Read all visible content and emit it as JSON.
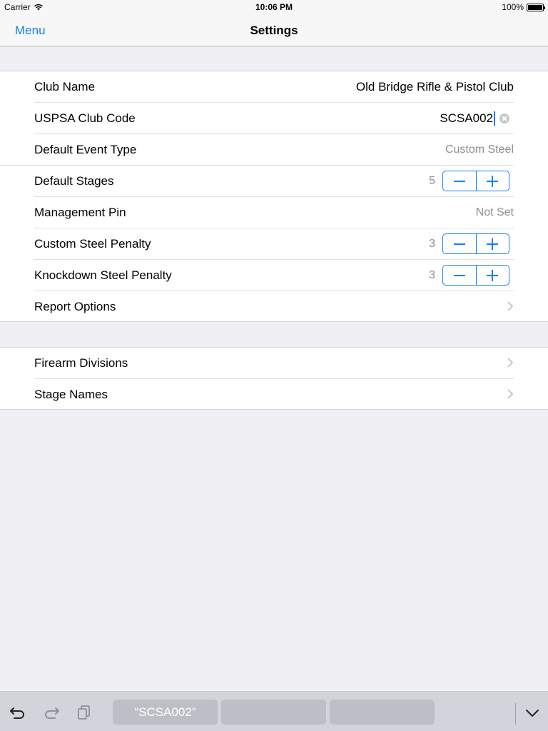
{
  "status": {
    "carrier": "Carrier",
    "time": "10:06 PM",
    "battery": "100%"
  },
  "nav": {
    "left": "Menu",
    "title": "Settings"
  },
  "section1": {
    "club_name": {
      "label": "Club Name",
      "value": "Old Bridge Rifle & Pistol Club"
    },
    "club_code": {
      "label": "USPSA Club Code",
      "value": "SCSA002"
    },
    "event_type": {
      "label": "Default Event Type",
      "value": "Custom Steel"
    },
    "stages": {
      "label": "Default Stages",
      "value": "5"
    },
    "pin": {
      "label": "Management Pin",
      "value": "Not Set"
    },
    "custom_penalty": {
      "label": "Custom Steel Penalty",
      "value": "3"
    },
    "knockdown_penalty": {
      "label": "Knockdown Steel Penalty",
      "value": "3"
    },
    "report": {
      "label": "Report Options"
    }
  },
  "section2": {
    "divisions": {
      "label": "Firearm Divisions"
    },
    "stage_names": {
      "label": "Stage Names"
    }
  },
  "keyboard": {
    "suggestions": [
      "“SCSA002”",
      "",
      ""
    ],
    "icons": [
      "undo-icon",
      "redo-icon",
      "paste-icon",
      "dismiss-keyboard-icon"
    ]
  },
  "colors": {
    "accent": "#157efb",
    "background": "#efeff4",
    "secondary_text": "#8e8e93"
  }
}
